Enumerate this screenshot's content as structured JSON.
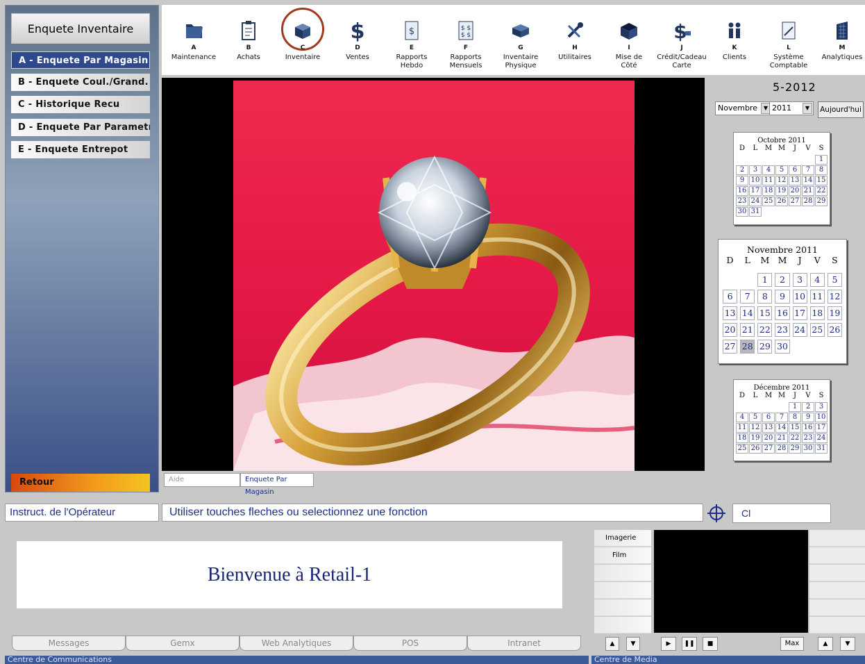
{
  "sidebar": {
    "title": "Enquete Inventaire",
    "items": [
      {
        "label": "A - Enquete Par Magasin"
      },
      {
        "label": "B - Enquete Coul./Grand."
      },
      {
        "label": "C - Historique Recu"
      },
      {
        "label": "D - Enquete Par Parametre"
      },
      {
        "label": "E - Enquete Entrepot"
      }
    ],
    "retour": "Retour"
  },
  "toolbar": [
    {
      "key": "A",
      "label1": "Maintenance",
      "label2": "",
      "icon": "folder-icon"
    },
    {
      "key": "B",
      "label1": "Achats",
      "label2": "",
      "icon": "clipboard-icon"
    },
    {
      "key": "C",
      "label1": "Inventaire",
      "label2": "",
      "icon": "box-icon"
    },
    {
      "key": "D",
      "label1": "Ventes",
      "label2": "",
      "icon": "dollar-icon"
    },
    {
      "key": "E",
      "label1": "Rapports",
      "label2": "Hebdo",
      "icon": "report-dollar-icon"
    },
    {
      "key": "F",
      "label1": "Rapports",
      "label2": "Mensuels",
      "icon": "report-multi-dollar-icon"
    },
    {
      "key": "G",
      "label1": "Inventaire",
      "label2": "Physique",
      "icon": "cube-icon"
    },
    {
      "key": "H",
      "label1": "Utilitaires",
      "label2": "",
      "icon": "tools-icon"
    },
    {
      "key": "I",
      "label1": "Mise de",
      "label2": "Côté",
      "icon": "open-box-icon"
    },
    {
      "key": "J",
      "label1": "Crédit/Cadeau",
      "label2": "Carte",
      "icon": "credit-dollar-icon"
    },
    {
      "key": "K",
      "label1": "Clients",
      "label2": "",
      "icon": "people-icon"
    },
    {
      "key": "L",
      "label1": "Système",
      "label2": "Comptable",
      "icon": "accounting-icon"
    },
    {
      "key": "M",
      "label1": "",
      "label2": "Analytiques",
      "icon": "building-chart-icon"
    }
  ],
  "image_tabs": {
    "aide": "Aide",
    "current": "Enquete Par Magasin"
  },
  "calendar": {
    "year_label": "5-2012",
    "month_select": "Novembre",
    "year_select": "2011",
    "today_button": "Aujourd'hui",
    "dow": [
      "D",
      "L",
      "M",
      "M",
      "J",
      "V",
      "S"
    ],
    "months": [
      {
        "title": "Octobre 2011",
        "offset": 6,
        "days": 31,
        "selected": 0
      },
      {
        "title": "Novembre 2011",
        "offset": 2,
        "days": 30,
        "selected": 28
      },
      {
        "title": "Décembre 2011",
        "offset": 4,
        "days": 31,
        "selected": 0
      }
    ]
  },
  "instructions": {
    "label": "Instruct. de l'Opérateur",
    "text": "Utiliser touches fleches ou selectionnez une fonction",
    "field": "Cl"
  },
  "comms": {
    "welcome": "Bienvenue à Retail-1",
    "tabs": [
      "Messages",
      "Gemx",
      "Web Analytiques",
      "POS",
      "Intranet"
    ],
    "footer": "Centre de Communications"
  },
  "media": {
    "items": [
      "Imagerie",
      "Film"
    ],
    "max_label": "Max",
    "footer": "Centre de Media"
  }
}
